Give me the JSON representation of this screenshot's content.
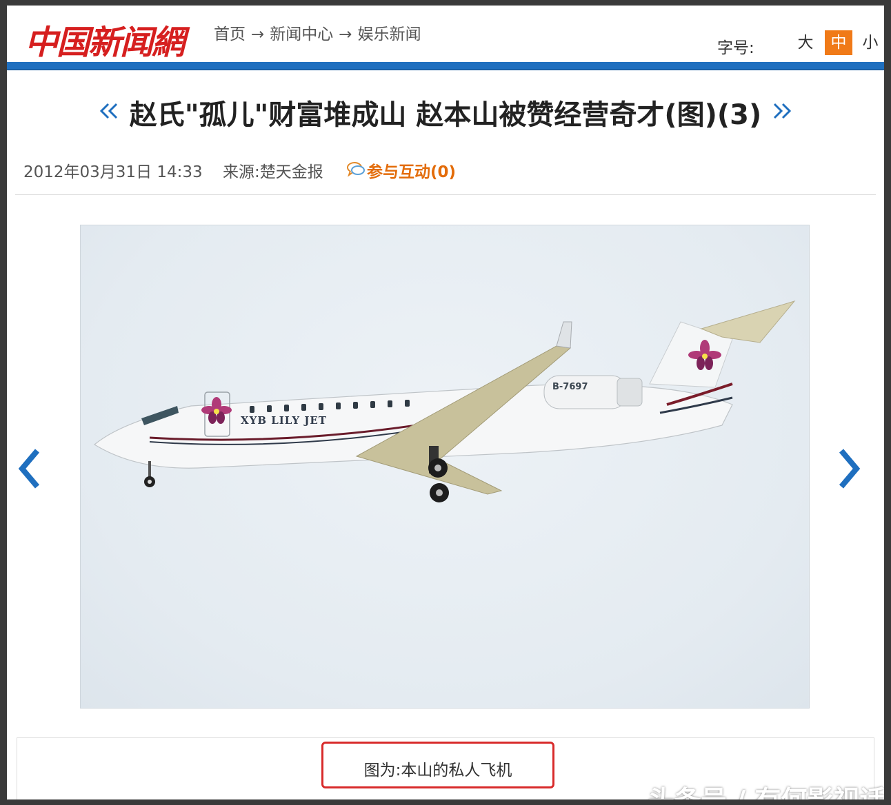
{
  "header": {
    "logo_text": "中国新闻網",
    "breadcrumb": [
      "首页",
      "新闻中心",
      "娱乐新闻"
    ],
    "breadcrumb_separator": "→",
    "font_size": {
      "label": "字号:",
      "large": "大",
      "medium": "中",
      "small": "小",
      "selected": "中"
    }
  },
  "article": {
    "title": "赵氏\"孤儿\"财富堆成山 赵本山被赞经营奇才(图)(3)",
    "date": "2012年03月31日 14:33",
    "source_label": "来源:",
    "source": "楚天金报",
    "interact": "参与互动(0)"
  },
  "photo": {
    "airplane_livery": "XYB LILY JET",
    "registration": "B-7697",
    "caption": "图为:本山的私人飞机"
  },
  "watermark": "头条号 / 有何影视话",
  "colors": {
    "brand_red": "#d61f1f",
    "header_blue": "#1f6fbf",
    "selected_orange": "#f07a18",
    "interact_orange": "#e36c0a",
    "highlight_red": "#d82a2a",
    "arrow_blue": "#1f6fbf"
  },
  "icons": {
    "prev_small": "double-chevron-left-icon",
    "next_small": "double-chevron-right-icon",
    "comment": "speech-bubble-icon",
    "prev_large": "chevron-left-icon",
    "next_large": "chevron-right-icon"
  }
}
